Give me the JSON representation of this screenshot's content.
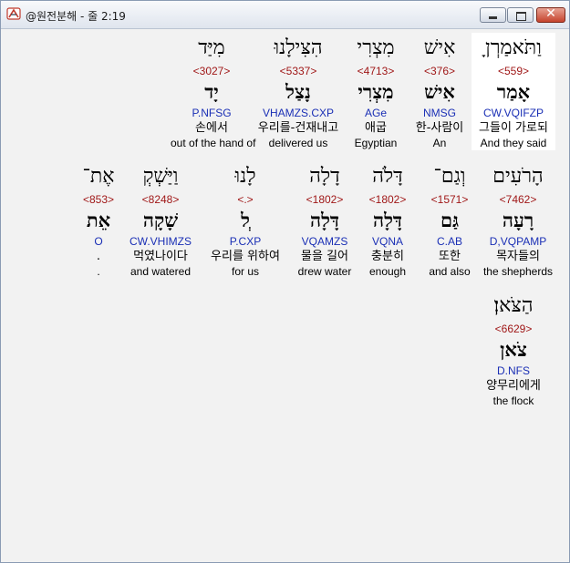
{
  "window": {
    "title": "@원전분해 - 줄 2:19",
    "min_label": "",
    "max_label": "",
    "close_label": "✕"
  },
  "rows": [
    {
      "words": [
        {
          "heb": "וַתֹּאמַרְןָ",
          "strong": "<559>",
          "lemma": "אָמַר",
          "parse": "CW.VQIFZP",
          "korean": "그들이 가로되",
          "english": "And they said"
        },
        {
          "heb": "אִישׁ",
          "strong": "<376>",
          "lemma": "אִישׁ",
          "parse": "NMSG",
          "korean": "한-사람이",
          "english": "An"
        },
        {
          "heb": "מִצְרִי",
          "strong": "<4713>",
          "lemma": "מִצְרִי",
          "parse": "AGe",
          "korean": "애굽",
          "english": "Egyptian"
        },
        {
          "heb": "הִצִּילָנוּ",
          "strong": "<5337>",
          "lemma": "נָצַל",
          "parse": "VHAMZS.CXP",
          "korean": "우리를-건재내고",
          "english": "delivered us"
        },
        {
          "heb": "מִיַּד",
          "strong": "<3027>",
          "lemma": "יָד",
          "parse": "P.NFSG",
          "korean": "손에서",
          "english": "out of the hand of"
        }
      ]
    },
    {
      "words": [
        {
          "heb": "הָרֹעִים",
          "strong": "<7462>",
          "lemma": "רָעָה",
          "parse": "D,VQPAMP",
          "korean": "목자들의",
          "english": "the shepherds"
        },
        {
          "heb": "וְגַם־",
          "strong": "<1571>",
          "lemma": "גַּם",
          "parse": "C.AB",
          "korean": "또한",
          "english": "and also"
        },
        {
          "heb": "דָּלֹה",
          "strong": "<1802>",
          "lemma": "דָּלָה",
          "parse": "VQNA",
          "korean": "충분히",
          "english": "enough"
        },
        {
          "heb": "דָלָה",
          "strong": "<1802>",
          "lemma": "דָּלָה",
          "parse": "VQAMZS",
          "korean": "물을 길어",
          "english": "drew water"
        },
        {
          "heb": "לָנוּ",
          "strong": "<.>",
          "lemma": "ְל",
          "parse": "P.CXP",
          "korean": "우리를 위하여",
          "english": "for us"
        },
        {
          "heb": "וַיַּשְׁקְ",
          "strong": "<8248>",
          "lemma": "שָׁקָה",
          "parse": "CW.VHIMZS",
          "korean": "먹였나이다",
          "english": "and watered"
        },
        {
          "heb": "אֶת־",
          "strong": "<853>",
          "lemma": "אֵת",
          "parse": "O",
          "korean": ".",
          "english": "."
        }
      ]
    },
    {
      "words": [
        {
          "heb": "הַצֹּאן׃",
          "strong": "<6629>",
          "lemma": "צֹאן",
          "parse": "D.NFS",
          "korean": "양무리에게",
          "english": "the flock"
        }
      ]
    }
  ]
}
